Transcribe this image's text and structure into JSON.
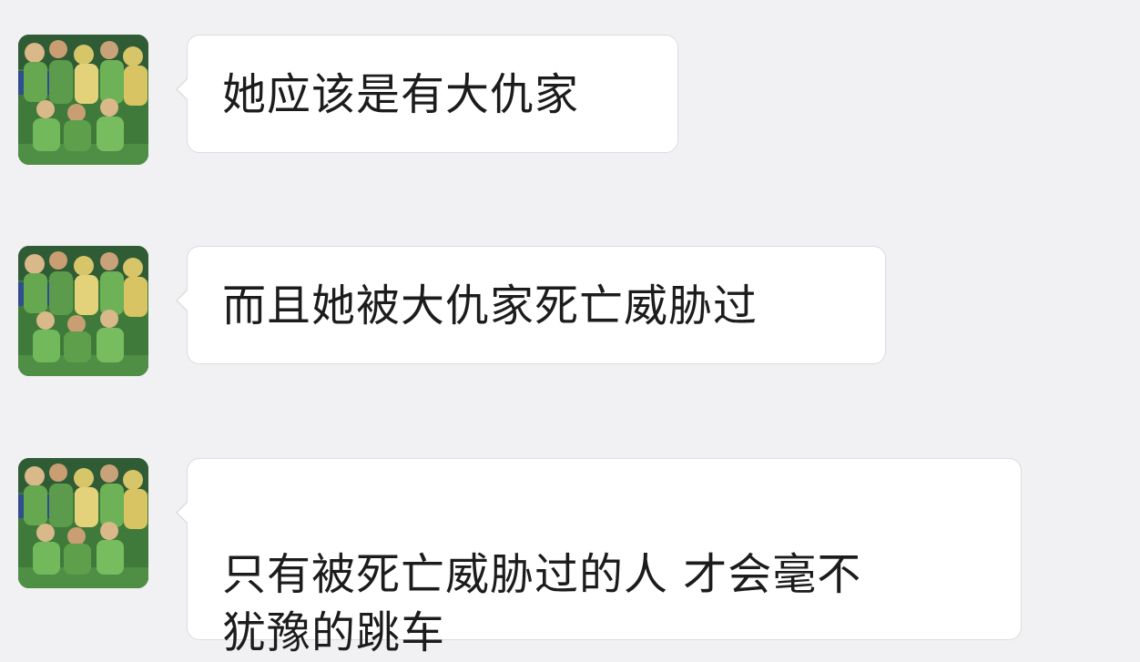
{
  "chat": {
    "messages": [
      {
        "sender_avatar": "group-photo-avatar",
        "text": "她应该是有大仇家"
      },
      {
        "sender_avatar": "group-photo-avatar",
        "text": "而且她被大仇家死亡威胁过"
      },
      {
        "sender_avatar": "group-photo-avatar",
        "text": "只有被死亡威胁过的人 才会毫不\n犹豫的跳车"
      }
    ]
  },
  "colors": {
    "background": "#f1f1f3",
    "bubble": "#ffffff",
    "bubble_border": "#dcdcdf",
    "text": "#1c1c1c",
    "avatar_green": "#3f7a3a",
    "avatar_yellow": "#d7c56a"
  }
}
